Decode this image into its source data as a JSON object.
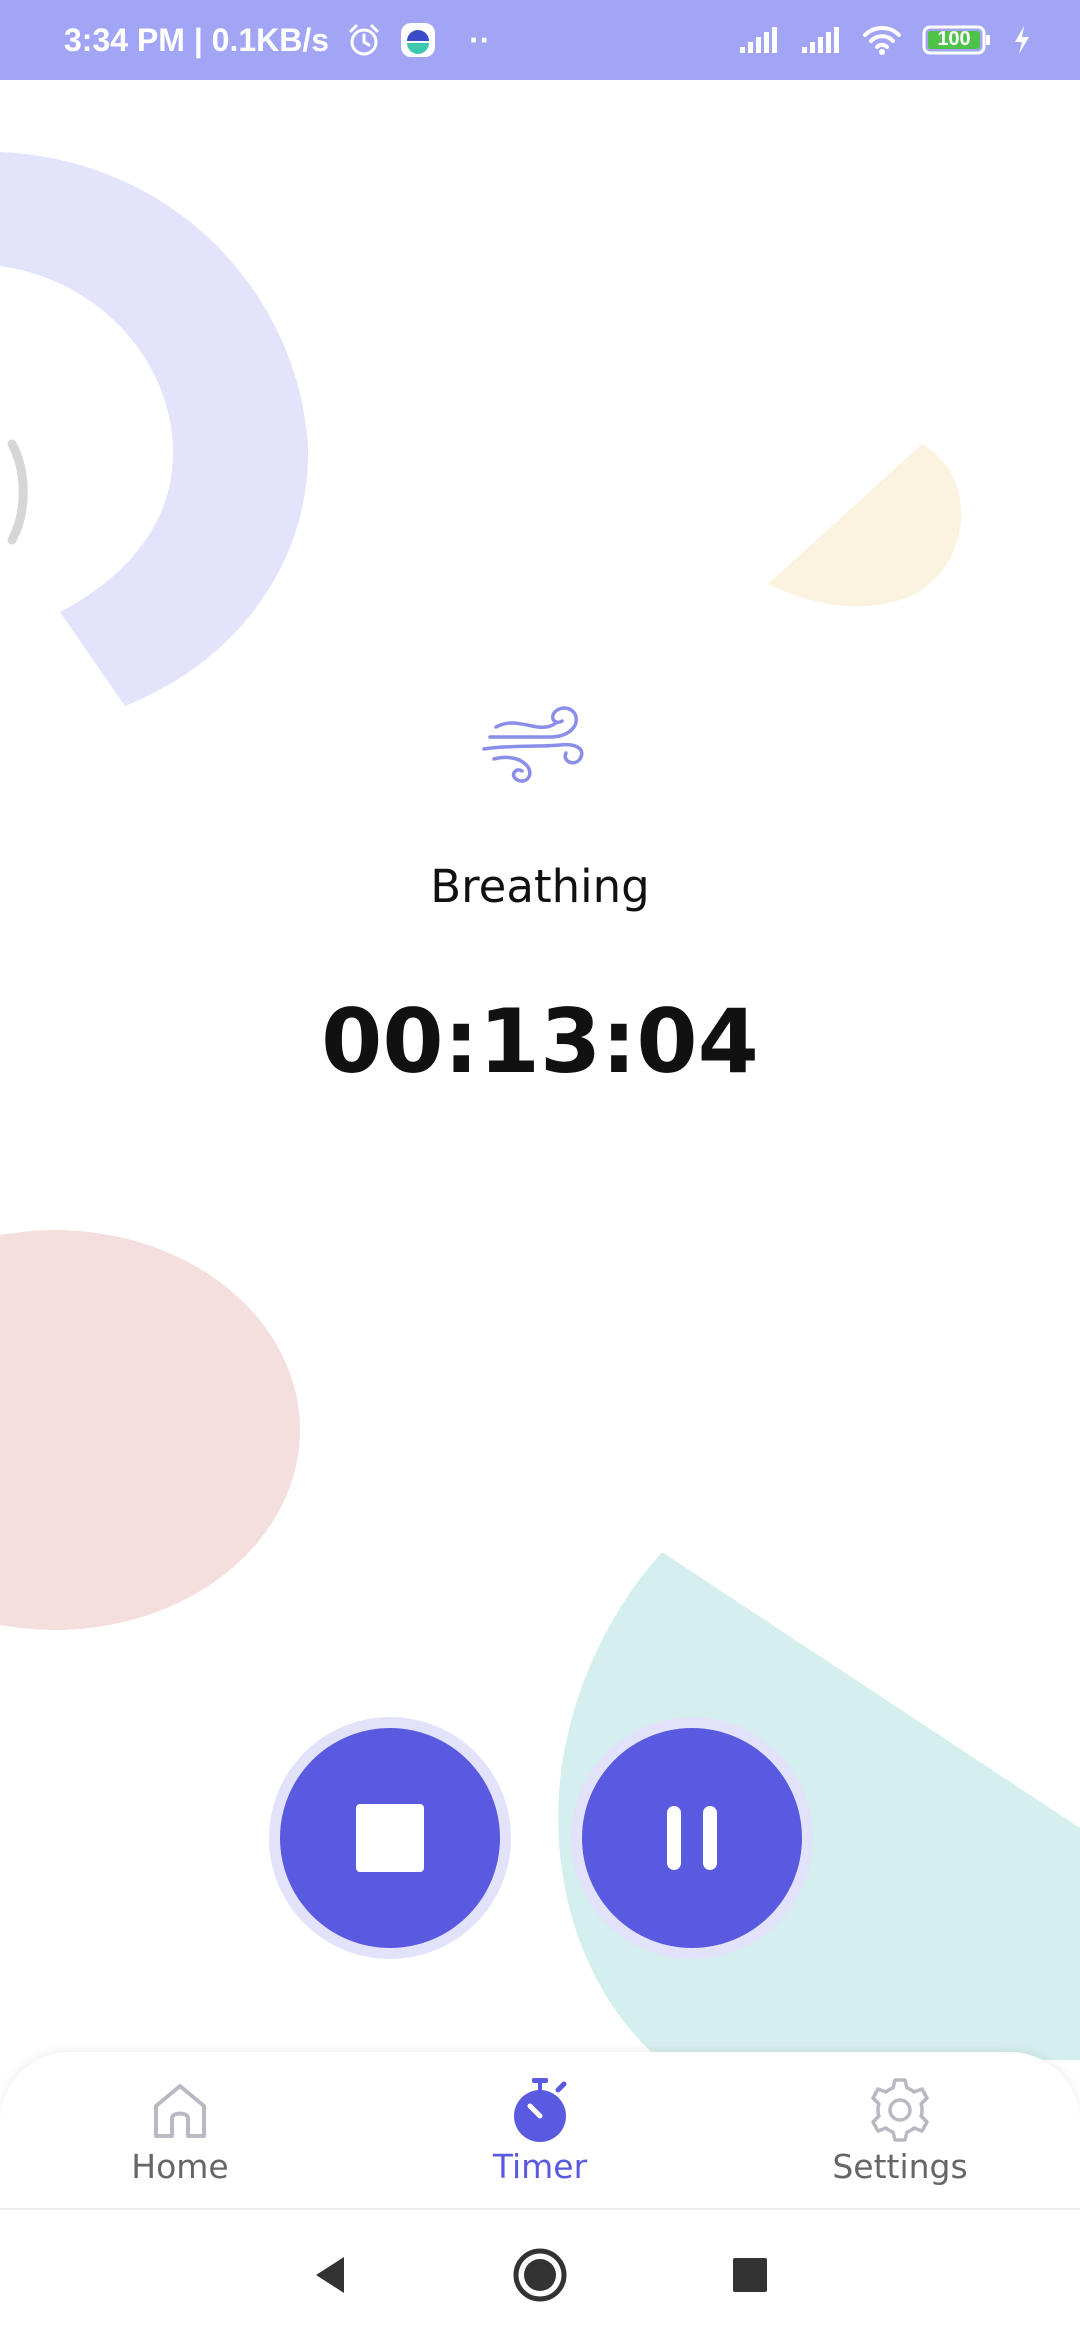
{
  "status_bar": {
    "time_speed": "3:34 PM | 0.1KB/s",
    "dots": "··",
    "battery": "100",
    "icons": [
      "alarm-icon",
      "app-notification-icon",
      "signal-icon",
      "signal-icon",
      "wifi-icon",
      "battery-icon",
      "charging-icon"
    ]
  },
  "activity": {
    "icon": "wind-icon",
    "name": "Breathing"
  },
  "timer": {
    "elapsed": "00:13:04"
  },
  "controls": {
    "stop_icon": "stop-icon",
    "pause_icon": "pause-icon"
  },
  "bottom_nav": {
    "items": [
      {
        "label": "Home",
        "icon": "home-icon",
        "active": false
      },
      {
        "label": "Timer",
        "icon": "stopwatch-icon",
        "active": true
      },
      {
        "label": "Settings",
        "icon": "gear-icon",
        "active": false
      }
    ]
  },
  "system_nav": {
    "buttons": [
      "back-icon",
      "home-circle-icon",
      "recents-icon"
    ]
  },
  "colors": {
    "accent": "#5a5ae0",
    "status_bar": "#a2a5f4",
    "deco_lavender": "#e3e3fc",
    "deco_pink": "#f5dede",
    "deco_teal": "#d5eeee",
    "deco_cream": "#fbf3df"
  }
}
